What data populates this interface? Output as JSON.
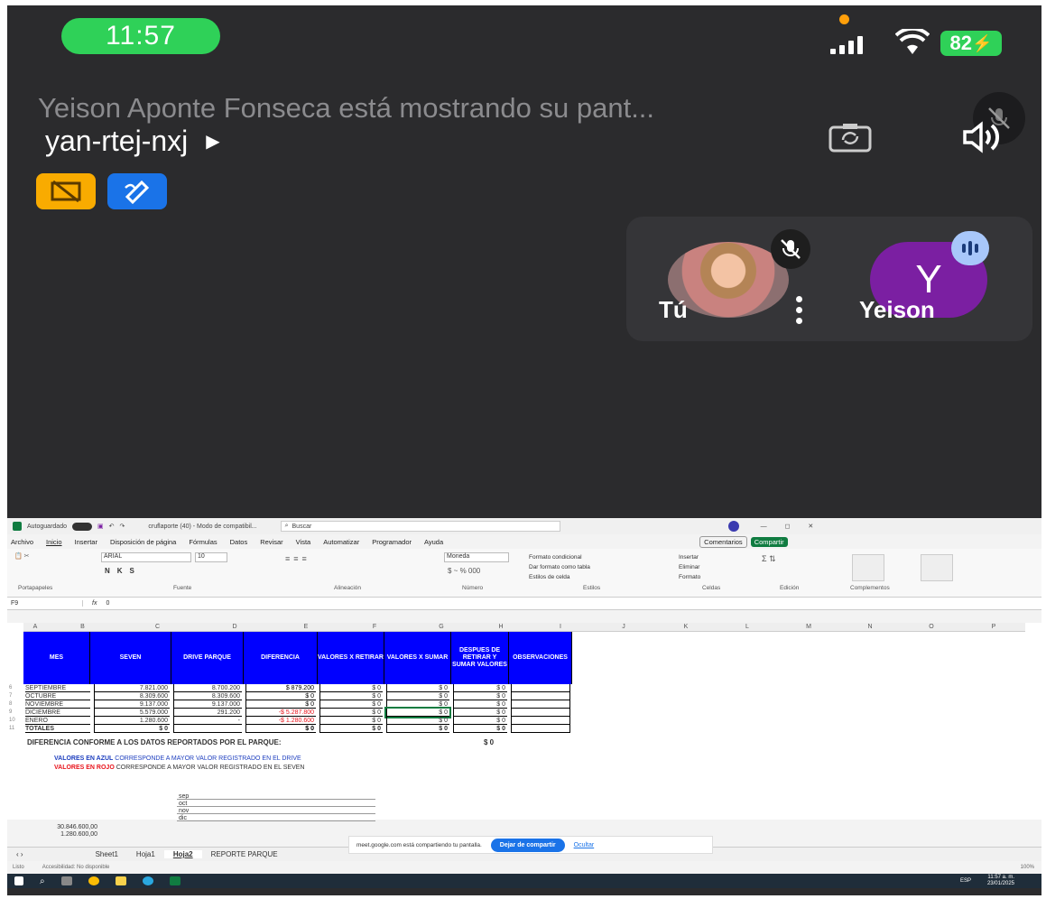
{
  "status_bar": {
    "time": "11:57",
    "battery": "82"
  },
  "meeting": {
    "sharing_text": "Yeison Aponte Fonseca está mostrando su pant...",
    "code": "yan-rtej-nxj"
  },
  "participants": [
    {
      "label": "Tú",
      "initial": ""
    },
    {
      "label": "Yeison",
      "initial": "Y"
    }
  ],
  "excel": {
    "autosave": "Autoguardado",
    "file_title": "cruflaporte (40) - Modo de compatibil...",
    "search": "Buscar",
    "menu": [
      "Archivo",
      "Inicio",
      "Insertar",
      "Disposición de página",
      "Fórmulas",
      "Datos",
      "Revisar",
      "Vista",
      "Automatizar",
      "Programador",
      "Ayuda"
    ],
    "comments": "Comentarios",
    "share": "Compartir",
    "font_name": "ARIAL",
    "font_size": "10",
    "number_format": "Moneda",
    "ribbon_groups": [
      "Portapapeles",
      "Fuente",
      "Alineación",
      "Número",
      "Estilos",
      "Celdas",
      "Edición",
      "Complementos"
    ],
    "styles": [
      "Formato condicional",
      "Dar formato como tabla",
      "Estilos de celda"
    ],
    "cells_cmds": [
      "Insertar",
      "Eliminar",
      "Formato"
    ],
    "name_box": "F9",
    "formula": "0",
    "columns": [
      "A",
      "B",
      "C",
      "D",
      "E",
      "F",
      "G",
      "H",
      "I",
      "J",
      "K",
      "L",
      "M",
      "N",
      "O",
      "P"
    ],
    "headers": [
      "MES",
      "SEVEN",
      "DRIVE PARQUE",
      "DIFERENCIA",
      "VALORES X RETIRAR",
      "VALORES X SUMAR",
      "DESPUES DE RETIRAR Y SUMAR VALORES",
      "OBSERVACIONES"
    ],
    "rows": [
      {
        "n": "6",
        "mes": "SEPTIEMBRE",
        "seven": "7.821.000",
        "drive": "8.700.200",
        "dif": "$ 879.200",
        "ret": "$ 0",
        "sum": "$ 0",
        "desp": "$ 0"
      },
      {
        "n": "7",
        "mes": "OCTUBRE",
        "seven": "8.309.600",
        "drive": "8.309.600",
        "dif": "$ 0",
        "ret": "$ 0",
        "sum": "$ 0",
        "desp": "$ 0"
      },
      {
        "n": "8",
        "mes": "NOVIEMBRE",
        "seven": "9.137.000",
        "drive": "9.137.000",
        "dif": "$ 0",
        "ret": "$ 0",
        "sum": "$ 0",
        "desp": "$ 0"
      },
      {
        "n": "9",
        "mes": "DICIEMBRE",
        "seven": "5.579.000",
        "drive": "291.200",
        "dif": "-$ 5.287.800",
        "ret": "$ 0",
        "sum": "$ 0",
        "desp": "$ 0"
      },
      {
        "n": "10",
        "mes": "ENERO",
        "seven": "1.280.600",
        "drive": "-",
        "dif": "-$ 1.280.600",
        "ret": "$ 0",
        "sum": "$ 0",
        "desp": "$ 0"
      },
      {
        "n": "11",
        "mes": "TOTALES",
        "seven": "$ 0",
        "drive": "",
        "dif": "$ 0",
        "ret": "$ 0",
        "sum": "$ 0",
        "desp": "$ 0"
      }
    ],
    "diferencia_label": "DIFERENCIA CONFORME A LOS DATOS REPORTADOS POR EL PARQUE:",
    "diferencia_value": "$ 0",
    "azul_bold": "VALORES EN AZUL",
    "azul_rest": "CORRESPONDE A MAYOR VALOR REGISTRADO EN EL DRIVE",
    "rojo_bold": "VALORES EN ROJO",
    "rojo_rest": "CORRESPONDE A MAYOR VALOR REGISTRADO EN EL SEVEN",
    "month_list": [
      "sep",
      "oct",
      "nov",
      "dic"
    ],
    "a24": "30.846.600,00",
    "a25": "1.280.600,00",
    "sheets": [
      "Sheet1",
      "Hoja1",
      "Hoja2",
      "REPORTE PARQUE"
    ],
    "status_left": "Listo",
    "accessibility": "Accesibilidad: No disponible",
    "share_notice": "meet.google.com está compartiendo tu pantalla.",
    "stop_share": "Dejar de compartir",
    "hide": "Ocultar",
    "zoom": "100%",
    "clock": "11:57 a. m.",
    "date": "23/01/2025",
    "lang": "ESP"
  },
  "colors": {
    "header_blue": "#0000ff",
    "red": "#e8141c",
    "pill_green": "#2fd158",
    "purple": "#7b1fa2"
  }
}
